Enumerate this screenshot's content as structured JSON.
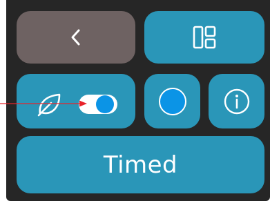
{
  "buttons": {
    "back_icon": "chevron-left-icon",
    "layout_icon": "layout-grid-icon",
    "eco_icon": "leaf-icon",
    "color_icon": "color-circle-icon",
    "info_icon": "info-icon",
    "timed_label": "Timed"
  },
  "toggle": {
    "state": "on"
  },
  "colors": {
    "panel": "#262626",
    "button": "#2a96b8",
    "back_button": "#6e6262",
    "accent": "#0b94e6",
    "annotation_arrow": "#e8232a"
  }
}
